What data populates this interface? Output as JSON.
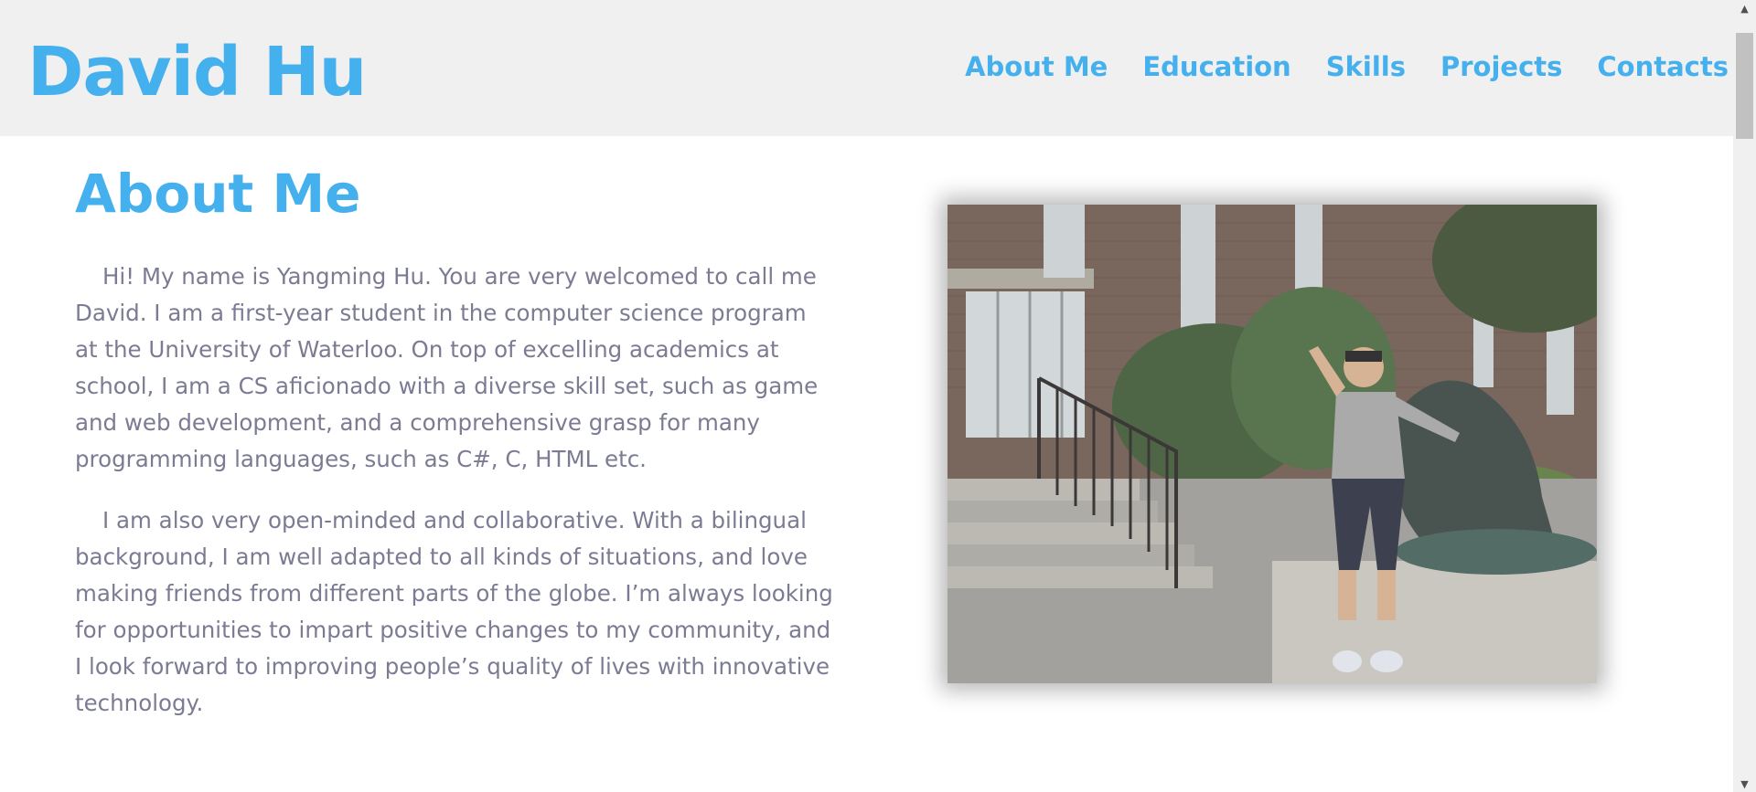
{
  "header": {
    "brand": "David Hu",
    "nav": [
      "About Me",
      "Education",
      "Skills",
      "Projects",
      "Contacts"
    ]
  },
  "about": {
    "title": "About Me",
    "paragraphs": [
      "Hi! My name is Yangming Hu. You are very welcomed to call me David. I am a first-year student in the computer science program at the University of Waterloo. On top of excelling academics at school, I am a CS aficionado with a diverse skill set, such as game and web development, and a comprehensive grasp for many programming languages, such as C#, C, HTML etc.",
      "I am also very open-minded and collaborative. With a bilingual background, I am well adapted to all kinds of situations, and love making friends from different parts of the globe. I’m always looking for opportunities to impart positive changes to my community, and I look forward to improving people’s quality of lives with innovative technology."
    ]
  },
  "colors": {
    "accent": "#45b0ee",
    "header_bg": "#f0f0f0",
    "body_text": "#7b7b93"
  },
  "icons": {
    "scroll_up": "scroll-up-arrow-icon",
    "scroll_down": "scroll-down-arrow-icon"
  }
}
